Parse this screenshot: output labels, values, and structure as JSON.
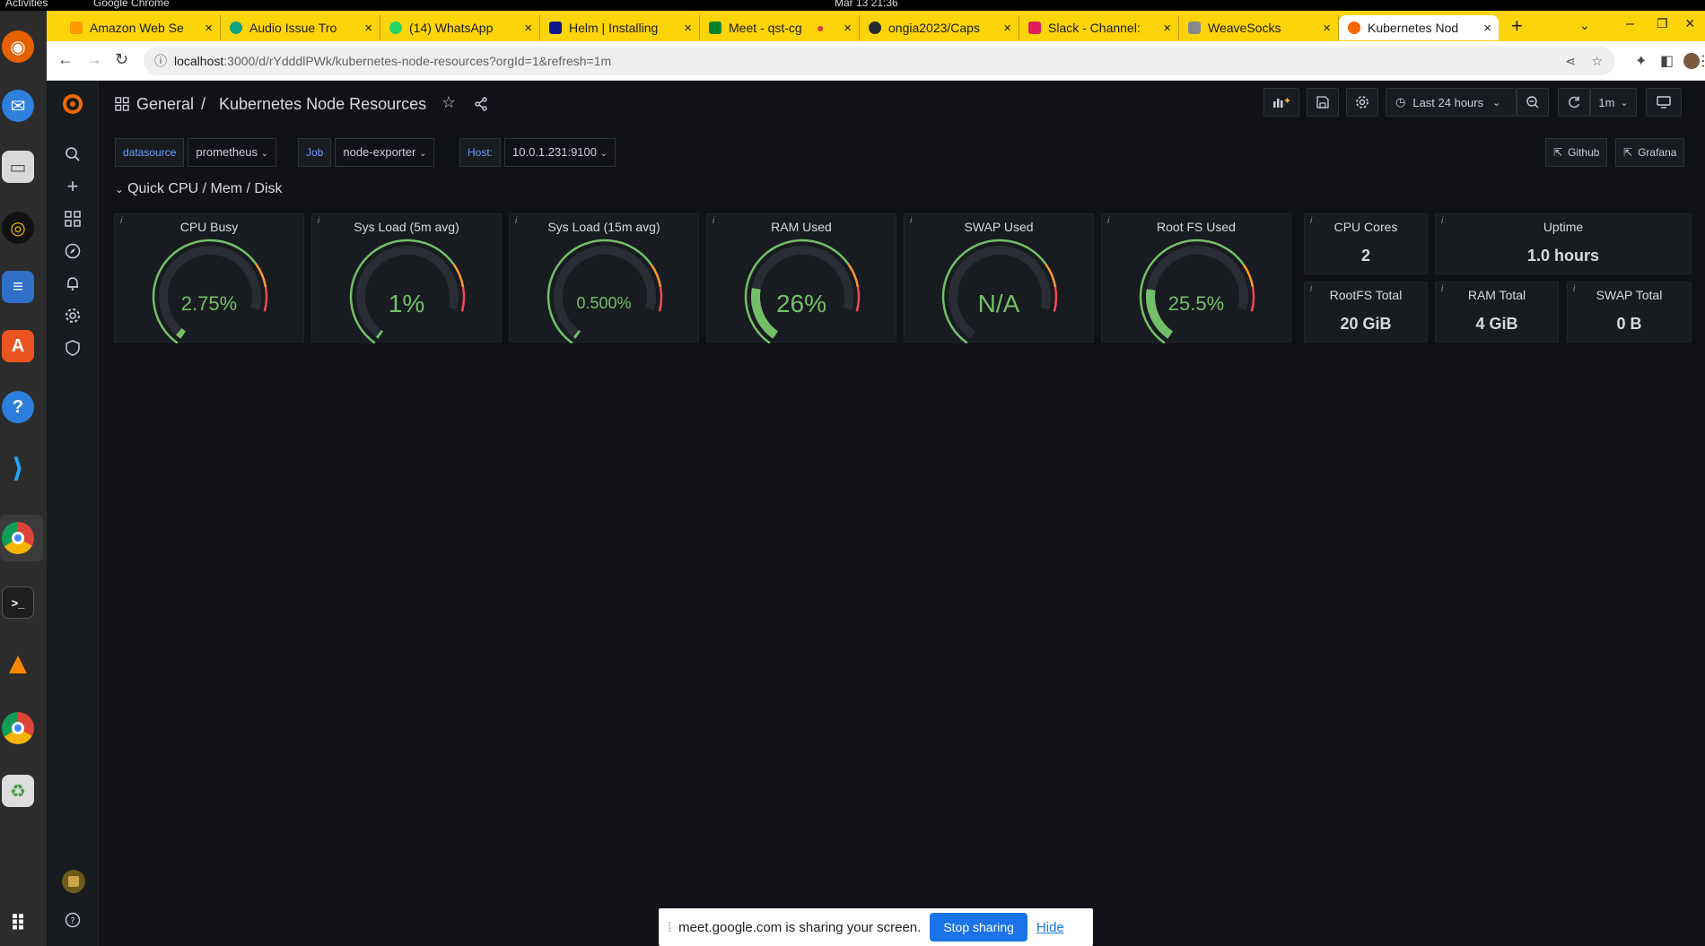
{
  "system": {
    "activities": "Activities",
    "app_name": "Google Chrome",
    "clock": "Mar 13 21:36"
  },
  "tabs": [
    {
      "title": "Amazon Web Se",
      "color": "#ff9900"
    },
    {
      "title": "Audio Issue Tro",
      "color": "#10a37f"
    },
    {
      "title": "(14) WhatsApp",
      "color": "#25d366"
    },
    {
      "title": "Helm | Installing",
      "color": "#0f1689"
    },
    {
      "title": "Meet - qst-cg",
      "color": "#00832d"
    },
    {
      "title": "ongia2023/Caps",
      "color": "#24292f"
    },
    {
      "title": "Slack - Channel:",
      "color": "#e01e5a"
    },
    {
      "title": "WeaveSocks",
      "color": "#888888"
    },
    {
      "title": "Kubernetes Nod",
      "color": "#f46800"
    }
  ],
  "address": {
    "host": "localhost",
    "path": ":3000/d/rYdddlPWk/kubernetes-node-resources?orgId=1&refresh=1m"
  },
  "header": {
    "breadcrumb_folder": "General",
    "breadcrumb_sep": "/",
    "title": "Kubernetes Node Resources",
    "time_range": "Last 24 hours",
    "refresh": "1m"
  },
  "variables": [
    {
      "label": "datasource",
      "value": "prometheus"
    },
    {
      "label": "Job",
      "value": "node-exporter"
    },
    {
      "label": "Host:",
      "value": "10.0.1.231:9100"
    }
  ],
  "links": [
    {
      "label": "Github"
    },
    {
      "label": "Grafana"
    }
  ],
  "row": {
    "title": "Quick CPU / Mem / Disk"
  },
  "gauges": [
    {
      "title": "CPU Busy",
      "value": "2.75%",
      "fraction": 0.0275
    },
    {
      "title": "Sys Load (5m avg)",
      "value": "1%",
      "fraction": 0.01
    },
    {
      "title": "Sys Load (15m avg)",
      "value": "0.500%",
      "fraction": 0.005
    },
    {
      "title": "RAM Used",
      "value": "26%",
      "fraction": 0.26
    },
    {
      "title": "SWAP Used",
      "value": "N/A",
      "fraction": 0
    },
    {
      "title": "Root FS Used",
      "value": "25.5%",
      "fraction": 0.255
    }
  ],
  "stats": [
    {
      "title": "CPU Cores",
      "value": "2"
    },
    {
      "title": "Uptime",
      "value": "1.0 hours"
    },
    {
      "title": "RootFS Total",
      "value": "20 GiB"
    },
    {
      "title": "RAM Total",
      "value": "4 GiB"
    },
    {
      "title": "SWAP Total",
      "value": "0 B"
    }
  ],
  "share_bar": {
    "message": "meet.google.com is sharing your screen.",
    "stop": "Stop sharing",
    "hide": "Hide"
  },
  "colors": {
    "ok": "#73bf69",
    "warn": "#ff9830",
    "crit": "#f2495c"
  }
}
